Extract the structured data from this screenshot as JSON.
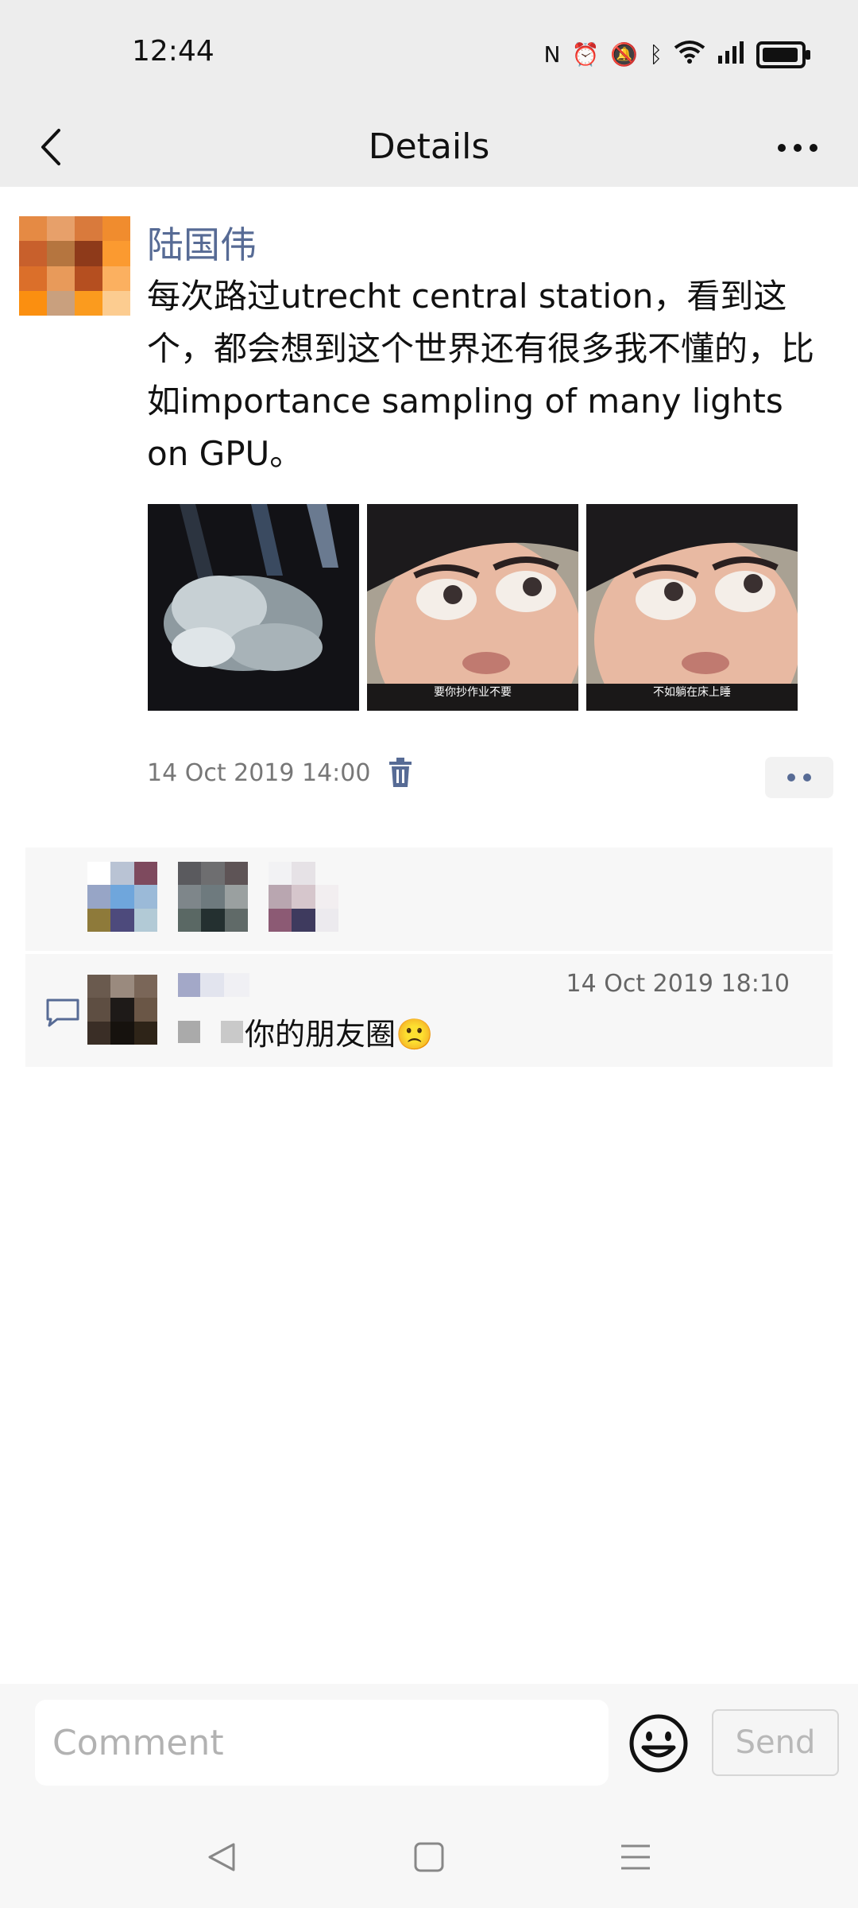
{
  "status_bar": {
    "time": "12:44"
  },
  "header": {
    "title": "Details"
  },
  "post": {
    "username": "陆国伟",
    "text": "每次路过utrecht central station，看到这个，都会想到这个世界还有很多我不懂的，比如importance sampling of many lights on GPU。",
    "photos": [
      {
        "caption": ""
      },
      {
        "caption": "要你抄作业不要"
      },
      {
        "caption": "不如躺在床上睡"
      }
    ],
    "timestamp": "14 Oct 2019 14:00"
  },
  "comment": {
    "timestamp": "14 Oct 2019 18:10",
    "text": "你的朋友圈🙁"
  },
  "input_bar": {
    "placeholder": "Comment",
    "send_label": "Send"
  },
  "colors": {
    "link_blue": "#576b95",
    "header_bg": "#ededed"
  },
  "icons": [
    "back-icon",
    "more-icon",
    "delete-icon",
    "comment-bubble-icon",
    "emoji-icon",
    "nav-back-icon",
    "nav-home-icon",
    "nav-menu-icon"
  ]
}
